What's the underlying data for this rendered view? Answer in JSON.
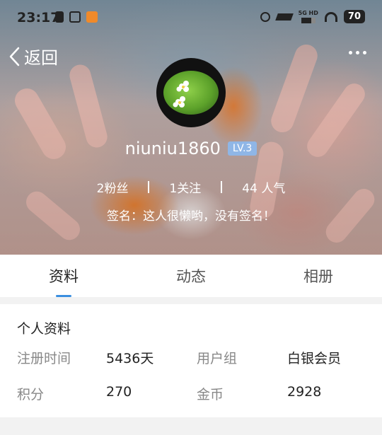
{
  "status_bar": {
    "time": "23:17",
    "network": "5G HD",
    "battery": "70"
  },
  "nav": {
    "back_label": "返回"
  },
  "profile": {
    "username": "niuniu1860",
    "level": "LV.3",
    "stats": {
      "fans": "2粉丝",
      "following": "1关注",
      "popularity": "44 人气"
    },
    "signature": "签名：这人很懒哟，没有签名！"
  },
  "tabs": [
    {
      "label": "资料",
      "active": true
    },
    {
      "label": "动态",
      "active": false
    },
    {
      "label": "相册",
      "active": false
    }
  ],
  "info": {
    "section_title": "个人资料",
    "register_time_label": "注册时间",
    "register_time_value": "5436天",
    "user_group_label": "用户组",
    "user_group_value": "白银会员",
    "points_label": "积分",
    "points_value": "270",
    "coins_label": "金币",
    "coins_value": "2928"
  },
  "colors": {
    "accent": "#3b8fe0",
    "level_badge": "#8fb6e6"
  }
}
